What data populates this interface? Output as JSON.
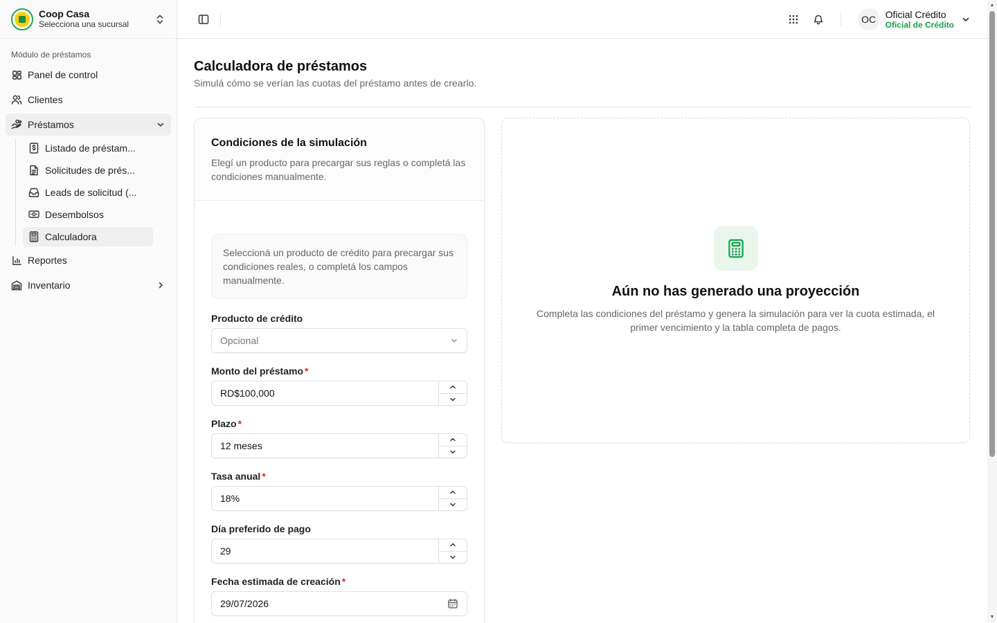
{
  "brand": {
    "name": "Coop Casa",
    "subtitle": "Selecciona una sucursal"
  },
  "sidebar": {
    "section_label": "Módulo de préstamos",
    "items": [
      {
        "label": "Panel de control",
        "icon": "dashboard-icon"
      },
      {
        "label": "Clientes",
        "icon": "users-icon"
      },
      {
        "label": "Préstamos",
        "icon": "loans-icon",
        "expanded": true
      },
      {
        "label": "Reportes",
        "icon": "chart-icon"
      },
      {
        "label": "Inventario",
        "icon": "inventory-icon"
      }
    ],
    "sub_items": [
      {
        "label": "Listado de préstam..."
      },
      {
        "label": "Solicitudes de prés..."
      },
      {
        "label": "Leads de solicitud (..."
      },
      {
        "label": "Desembolsos"
      },
      {
        "label": "Calculadora",
        "active": true
      }
    ]
  },
  "header": {
    "user_initials": "OC",
    "user_name": "Oficial Crédito",
    "user_role": "Oficial de Crédito"
  },
  "page": {
    "title": "Calculadora de préstamos",
    "subtitle": "Simulá cómo se verían las cuotas del préstamo antes de crearlo."
  },
  "form": {
    "title": "Condiciones de la simulación",
    "description": "Elegí un producto para precargar sus reglas o completá las condiciones manualmente.",
    "hint": "Seleccioná un producto de crédito para precargar sus condiciones reales, o completá los campos manualmente.",
    "product_label": "Producto de crédito",
    "product_placeholder": "Opcional",
    "amount_label": "Monto del préstamo",
    "amount_value": "RD$100,000",
    "term_label": "Plazo",
    "term_value": "12 meses",
    "rate_label": "Tasa anual",
    "rate_value": "18%",
    "payday_label": "Día preferido de pago",
    "payday_value": "29",
    "date_label": "Fecha estimada de creación",
    "date_value": "29/07/2026",
    "required_mark": "*"
  },
  "empty_state": {
    "title": "Aún no has generado una proyección",
    "description": "Completa las condiciones del préstamo y genera la simulación para ver la cuota estimada, el primer vencimiento y la tabla completa de pagos."
  },
  "colors": {
    "accent": "#16a34a",
    "required": "#dc2626"
  }
}
